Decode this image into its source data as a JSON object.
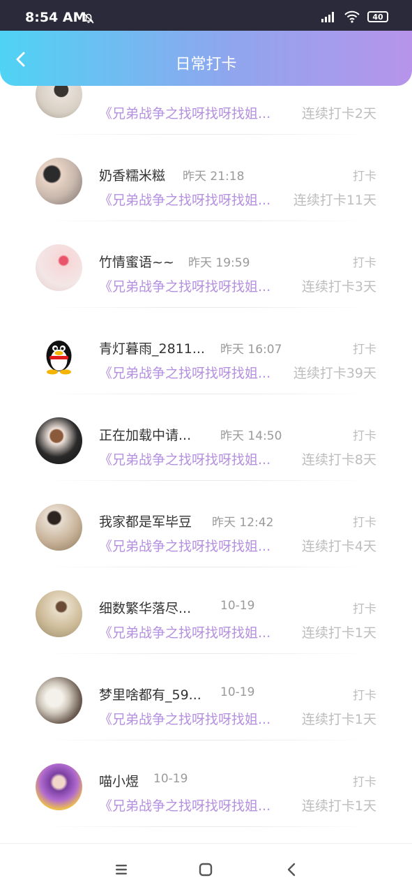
{
  "status": {
    "time": "8:54 AM",
    "battery": "40"
  },
  "header": {
    "title": "日常打卡"
  },
  "entries": [
    {
      "name": "",
      "time": "",
      "tag": "",
      "book": "《兄弟战争之找呀找呀找姐...",
      "streak": "连续打卡2天"
    },
    {
      "name": "奶香糯米糍",
      "time": "昨天 21:18",
      "tag": "打卡",
      "book": "《兄弟战争之找呀找呀找姐...",
      "streak": "连续打卡11天"
    },
    {
      "name": "竹情蜜语~~",
      "time": "昨天 19:59",
      "tag": "打卡",
      "book": "《兄弟战争之找呀找呀找姐...",
      "streak": "连续打卡3天"
    },
    {
      "name": "青灯暮雨_2811...",
      "time": "昨天 16:07",
      "tag": "打卡",
      "book": "《兄弟战争之找呀找呀找姐...",
      "streak": "连续打卡39天"
    },
    {
      "name": "正在加载中请...",
      "time": "昨天 14:50",
      "tag": "打卡",
      "book": "《兄弟战争之找呀找呀找姐...",
      "streak": "连续打卡8天"
    },
    {
      "name": "我家都是军毕豆",
      "time": "昨天 12:42",
      "tag": "打卡",
      "book": "《兄弟战争之找呀找呀找姐...",
      "streak": "连续打卡4天"
    },
    {
      "name": "细数繁华落尽...",
      "time": "10-19",
      "tag": "打卡",
      "book": "《兄弟战争之找呀找呀找姐...",
      "streak": "连续打卡1天"
    },
    {
      "name": "梦里啥都有_59...",
      "time": "10-19",
      "tag": "打卡",
      "book": "《兄弟战争之找呀找呀找姐...",
      "streak": "连续打卡1天"
    },
    {
      "name": "喵小煜",
      "time": "10-19",
      "tag": "打卡",
      "book": "《兄弟战争之找呀找呀找姐...",
      "streak": "连续打卡1天"
    }
  ],
  "icons": {
    "back": "chevron-left-icon",
    "menu": "menu-icon",
    "home": "home-square-icon",
    "nav_back": "back-icon"
  }
}
